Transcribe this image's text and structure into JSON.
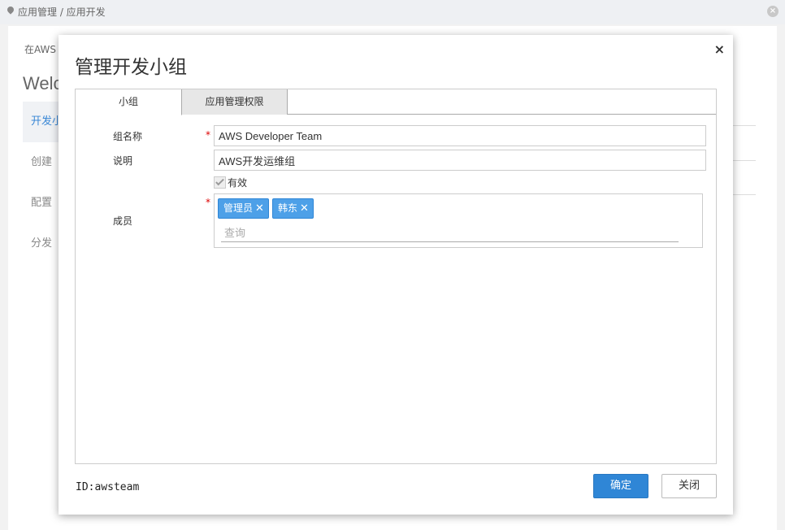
{
  "breadcrumb": {
    "text": "应用管理 / 应用开发"
  },
  "background": {
    "intro": "在AWS",
    "welcome": "Welc",
    "nav": [
      "开发小",
      "创建",
      "配置",
      "分发"
    ]
  },
  "modal": {
    "title": "管理开发小组",
    "close": "×",
    "tabs": [
      {
        "label": "小组"
      },
      {
        "label": "应用管理权限"
      }
    ],
    "form": {
      "name_label": "组名称",
      "name_value": "AWS Developer Team",
      "desc_label": "说明",
      "desc_value": "AWS开发运维组",
      "valid_label": "有效",
      "members_label": "成员",
      "required_mark": "*",
      "members": [
        {
          "name": "管理员",
          "remove": "✕"
        },
        {
          "name": "韩东",
          "remove": "✕"
        }
      ],
      "search_placeholder": "查询"
    },
    "footer": {
      "id_text": "ID:awsteam",
      "ok_label": "确定",
      "close_label": "关闭"
    }
  },
  "colors": {
    "accent": "#2f86d6",
    "tag": "#4da0e8",
    "required": "#dd0000"
  }
}
